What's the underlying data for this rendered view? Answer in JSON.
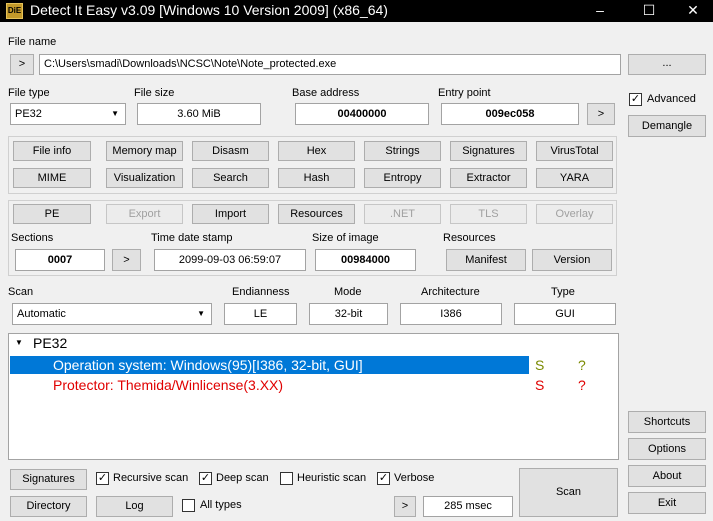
{
  "window": {
    "title": "Detect It Easy v3.09 [Windows 10 Version 2009] (x86_64)",
    "app_icon_text": "DiE",
    "minimize": "–",
    "maximize": "☐",
    "close": "✕"
  },
  "file": {
    "label": "File name",
    "open_arrow": ">",
    "path": "C:\\Users\\smadi\\Downloads\\NCSC\\Note\\Note_protected.exe",
    "browse": "..."
  },
  "info": {
    "file_type_label": "File type",
    "file_type_value": "PE32",
    "file_size_label": "File size",
    "file_size_value": "3.60 MiB",
    "base_address_label": "Base address",
    "base_address_value": "00400000",
    "entry_point_label": "Entry point",
    "entry_point_value": "009ec058",
    "entry_point_btn": ">"
  },
  "right": {
    "advanced_label": "Advanced",
    "advanced_checked": "✓",
    "demangle": "Demangle",
    "shortcuts": "Shortcuts",
    "options": "Options",
    "about": "About",
    "exit": "Exit"
  },
  "tools": {
    "row1": [
      "File info",
      "Memory map",
      "Disasm",
      "Hex",
      "Strings",
      "Signatures",
      "VirusTotal"
    ],
    "row2": [
      "MIME",
      "Visualization",
      "Search",
      "Hash",
      "Entropy",
      "Extractor",
      "YARA"
    ]
  },
  "pe": {
    "buttons": [
      "PE",
      "Export",
      "Import",
      "Resources",
      ".NET",
      "TLS",
      "Overlay"
    ],
    "sections_label": "Sections",
    "sections_value": "0007",
    "sections_btn": ">",
    "timestamp_label": "Time date stamp",
    "timestamp_value": "2099-09-03 06:59:07",
    "size_of_image_label": "Size of image",
    "size_of_image_value": "00984000",
    "resources_label": "Resources",
    "manifest": "Manifest",
    "version": "Version"
  },
  "scan": {
    "label": "Scan",
    "mode_value": "Automatic",
    "endianness_label": "Endianness",
    "endianness_value": "LE",
    "mode_label": "Mode",
    "bitness_value": "32-bit",
    "architecture_label": "Architecture",
    "architecture_value": "I386",
    "type_label": "Type",
    "type_value": "GUI"
  },
  "results": {
    "root": "PE32",
    "rows": [
      {
        "text": "Operation system: Windows(95)[I386, 32-bit, GUI]",
        "s": "S",
        "q": "?"
      },
      {
        "text": "Protector: Themida/Winlicense(3.XX)",
        "s": "S",
        "q": "?"
      }
    ]
  },
  "bottom": {
    "signatures": "Signatures",
    "recursive_scan": "Recursive scan",
    "deep_scan": "Deep scan",
    "heuristic_scan": "Heuristic scan",
    "verbose": "Verbose",
    "directory": "Directory",
    "log": "Log",
    "all_types": "All types",
    "more": ">",
    "time": "285 msec",
    "scan_btn": "Scan",
    "check": "✓"
  },
  "colors": {
    "selection": "#0078d7",
    "detect_red": "#e00000",
    "s_green": "#7a8a00"
  }
}
